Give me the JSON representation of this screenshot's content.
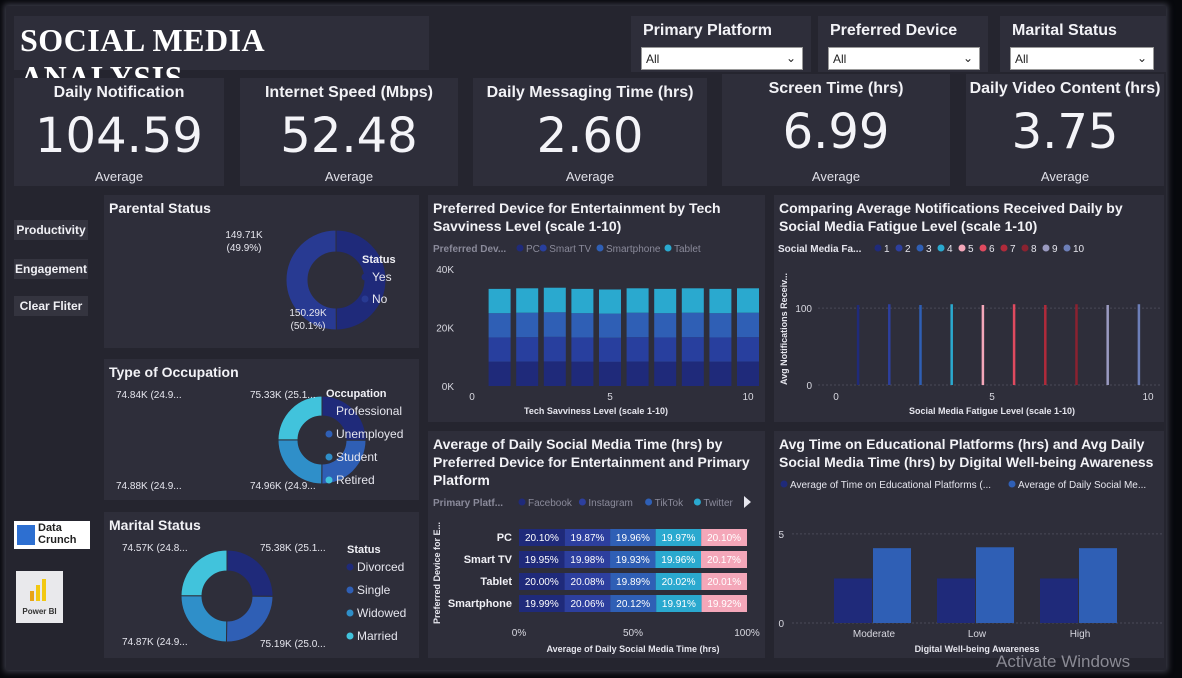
{
  "title": "SOCIAL MEDIA ANALYSIS",
  "slicers": [
    {
      "label": "Primary Platform",
      "value": "All"
    },
    {
      "label": "Preferred Device",
      "value": "All"
    },
    {
      "label": "Marital Status",
      "value": "All"
    }
  ],
  "kpis": [
    {
      "label": "Daily Notification",
      "value": "104.59",
      "sub": "Average"
    },
    {
      "label": "Internet Speed (Mbps)",
      "value": "52.48",
      "sub": "Average"
    },
    {
      "label": "Daily Messaging Time (hrs)",
      "value": "2.60",
      "sub": "Average"
    },
    {
      "label": "Screen Time (hrs)",
      "value": "6.99",
      "sub": "Average"
    },
    {
      "label": "Daily Video Content (hrs)",
      "value": "3.75",
      "sub": "Average"
    }
  ],
  "nav": {
    "productivity": "Productivity",
    "engagement": "Engagement",
    "clear": "Clear Fliter"
  },
  "logos": {
    "datacrunch_line1": "Data",
    "datacrunch_line2": "Crunch",
    "powerbi": "Power BI"
  },
  "watermark": "Activate Windows",
  "colors": {
    "dark_blue": "#1f2a7a",
    "mid_blue": "#2f5fb5",
    "teal": "#2aa9cf",
    "light_teal": "#41c3dc",
    "pink": "#f4a7b9"
  },
  "chart_data": [
    {
      "id": "parental",
      "type": "pie",
      "title": "Parental Status",
      "legend_title": "Status",
      "slices": [
        {
          "name": "Yes",
          "value": 149.71,
          "label": "149.71K",
          "pct": "(49.9%)"
        },
        {
          "name": "No",
          "value": 150.29,
          "label": "150.29K",
          "pct": "(50.1%)"
        }
      ]
    },
    {
      "id": "occupation",
      "type": "pie",
      "title": "Type of Occupation",
      "legend_title": "Occupation",
      "slices": [
        {
          "name": "Professional",
          "value": 75.33,
          "label": "75.33K (25.1..."
        },
        {
          "name": "Unemployed",
          "value": 74.96,
          "label": "74.96K (24.9..."
        },
        {
          "name": "Student",
          "value": 74.88,
          "label": "74.88K (24.9..."
        },
        {
          "name": "Retired",
          "value": 74.84,
          "label": "74.84K (24.9..."
        }
      ]
    },
    {
      "id": "marital",
      "type": "pie",
      "title": "Marital Status",
      "legend_title": "Status",
      "slices": [
        {
          "name": "Divorced",
          "value": 75.38,
          "label": "75.38K (25.1..."
        },
        {
          "name": "Single",
          "value": 75.19,
          "label": "75.19K (25.0..."
        },
        {
          "name": "Widowed",
          "value": 74.87,
          "label": "74.87K (24.9..."
        },
        {
          "name": "Married",
          "value": 74.57,
          "label": "74.57K (24.8..."
        }
      ]
    },
    {
      "id": "device_tech",
      "type": "bar",
      "title": "Preferred Device for Entertainment by Tech Savviness Level (scale 1-10)",
      "legend_title": "Preferred Dev...",
      "xlabel": "Tech Savviness Level (scale 1-10)",
      "x": [
        1,
        2,
        3,
        4,
        5,
        6,
        7,
        8,
        9,
        10
      ],
      "xticks": [
        0,
        5,
        10
      ],
      "yticks": [
        "0K",
        "20K",
        "40K"
      ],
      "ylim": [
        0,
        40000
      ],
      "series": [
        {
          "name": "PC",
          "values": [
            8300,
            8350,
            8400,
            8300,
            8250,
            8350,
            8300,
            8350,
            8300,
            8350
          ]
        },
        {
          "name": "Smart TV",
          "values": [
            8300,
            8350,
            8400,
            8300,
            8250,
            8350,
            8300,
            8350,
            8300,
            8350
          ]
        },
        {
          "name": "Smartphone",
          "values": [
            8300,
            8350,
            8400,
            8300,
            8250,
            8350,
            8300,
            8350,
            8300,
            8350
          ]
        },
        {
          "name": "Tablet",
          "values": [
            8300,
            8350,
            8400,
            8300,
            8250,
            8350,
            8300,
            8350,
            8300,
            8350
          ]
        }
      ]
    },
    {
      "id": "fatigue",
      "type": "bar",
      "title": "Comparing Average Notifications Received Daily by Social Media Fatigue Level (scale 1-10)",
      "legend_title": "Social Media Fa...",
      "ylabel": "Avg Notifications Receiv...",
      "xlabel": "Social Media Fatigue Level (scale 1-10)",
      "x": [
        1,
        2,
        3,
        4,
        5,
        6,
        7,
        8,
        9,
        10
      ],
      "values": [
        104,
        105,
        104,
        105,
        104,
        105,
        104,
        105,
        104,
        105
      ],
      "xticks": [
        0,
        5,
        10
      ],
      "yticks": [
        "0",
        "100"
      ],
      "ylim": [
        0,
        130
      ]
    },
    {
      "id": "platform_device",
      "type": "bar",
      "title": "Average of Daily Social Media Time (hrs) by Preferred Device for Entertainment and Primary Platform",
      "legend_title": "Primary Platf...",
      "xlabel": "Average of Daily Social Media Time (hrs)",
      "ylabel": "Preferred Device for E...",
      "xticks": [
        "0%",
        "50%",
        "100%"
      ],
      "categories": [
        "PC",
        "Smart TV",
        "Tablet",
        "Smartphone"
      ],
      "series": [
        {
          "name": "Facebook",
          "values": [
            20.1,
            19.95,
            20.0,
            19.99
          ],
          "labels": [
            "20.10%",
            "19.95%",
            "20.00%",
            "19.99%"
          ]
        },
        {
          "name": "Instagram",
          "values": [
            19.87,
            19.98,
            20.08,
            20.06
          ],
          "labels": [
            "19.87%",
            "19.98%",
            "20.08%",
            "20.06%"
          ]
        },
        {
          "name": "TikTok",
          "values": [
            19.96,
            19.93,
            19.89,
            20.12
          ],
          "labels": [
            "19.96%",
            "19.93%",
            "19.89%",
            "20.12%"
          ]
        },
        {
          "name": "Twitter",
          "values": [
            19.97,
            19.96,
            20.02,
            19.91
          ],
          "labels": [
            "19.97%",
            "19.96%",
            "20.02%",
            "19.91%"
          ]
        },
        {
          "name": "",
          "values": [
            20.1,
            20.17,
            20.01,
            19.92
          ],
          "labels": [
            "20.10%",
            "20.17%",
            "20.01%",
            "19.92%"
          ]
        }
      ]
    },
    {
      "id": "education",
      "type": "bar",
      "title": "Avg Time on Educational Platforms (hrs) and Avg Daily Social Media Time (hrs) by Digital Well-being Awareness",
      "xlabel": "Digital Well-being Awareness",
      "categories": [
        "Moderate",
        "Low",
        "High"
      ],
      "yticks": [
        "0",
        "5"
      ],
      "ylim": [
        0,
        5.5
      ],
      "series": [
        {
          "name": "Average of Time on Educational Platforms (...",
          "values": [
            2.5,
            2.5,
            2.5
          ]
        },
        {
          "name": "Average of Daily Social Me...",
          "values": [
            4.2,
            4.25,
            4.2
          ]
        }
      ]
    }
  ]
}
